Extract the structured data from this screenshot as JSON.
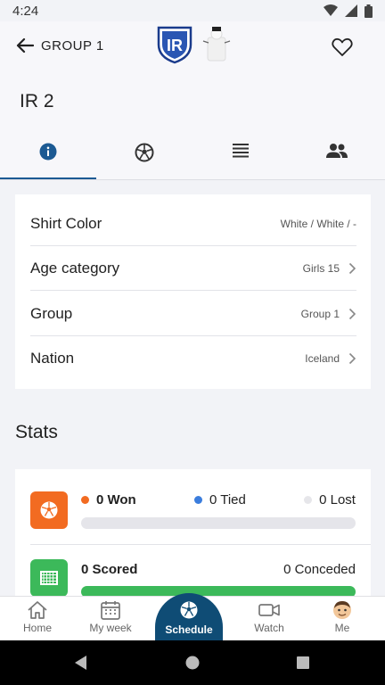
{
  "status_bar": {
    "time": "4:24"
  },
  "header": {
    "back_label": "GROUP 1",
    "crest_text": "IR",
    "team_name": "IR 2"
  },
  "tabs": [
    {
      "name": "info",
      "icon": "info-icon",
      "active": true
    },
    {
      "name": "matches",
      "icon": "soccer-ball-icon",
      "active": false
    },
    {
      "name": "standings",
      "icon": "list-icon",
      "active": false
    },
    {
      "name": "players",
      "icon": "people-icon",
      "active": false
    }
  ],
  "info": {
    "rows": [
      {
        "label": "Shirt Color",
        "value": "White / White / -",
        "chevron": false
      },
      {
        "label": "Age category",
        "value": "Girls 15",
        "chevron": true
      },
      {
        "label": "Group",
        "value": "Group 1",
        "chevron": true
      },
      {
        "label": "Nation",
        "value": "Iceland",
        "chevron": true
      }
    ]
  },
  "stats": {
    "title": "Stats",
    "won": "0 Won",
    "tied": "0 Tied",
    "lost": "0 Lost",
    "scored": "0 Scored",
    "conceded": "0 Conceded",
    "colors": {
      "won": "#f26b21",
      "tied": "#3b7ddd",
      "lost": "#e6e6ea",
      "goal": "#3cb95a"
    }
  },
  "bottom_nav": {
    "home": "Home",
    "my_week": "My week",
    "schedule": "Schedule",
    "watch": "Watch",
    "me": "Me"
  },
  "colors": {
    "accent": "#1c5a93",
    "nav_center": "#0f4c75"
  }
}
